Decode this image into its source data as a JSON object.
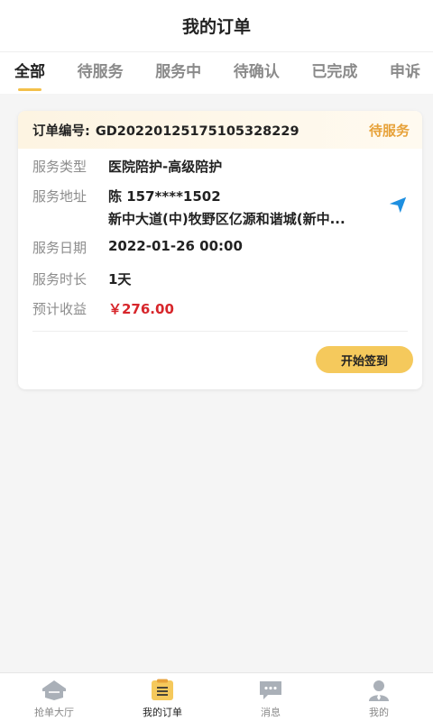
{
  "header": {
    "title": "我的订单"
  },
  "tabs": [
    {
      "label": "全部",
      "active": true
    },
    {
      "label": "待服务"
    },
    {
      "label": "服务中"
    },
    {
      "label": "待确认"
    },
    {
      "label": "已完成"
    },
    {
      "label": "申诉"
    }
  ],
  "order": {
    "number_label": "订单编号:",
    "number": "GD20220125175105328229",
    "status": "待服务",
    "service_type_label": "服务类型",
    "service_type": "医院陪护-高级陪护",
    "address_label": "服务地址",
    "contact": "陈 157****1502",
    "address": "新中大道(中)牧野区亿源和谐城(新中...",
    "date_label": "服务日期",
    "date": "2022-01-26 00:00",
    "duration_label": "服务时长",
    "duration": "1天",
    "income_label": "预计收益",
    "income": "￥276.00",
    "action_label": "开始签到"
  },
  "tabbar": [
    {
      "label": "抢单大厅",
      "icon": "hall-icon"
    },
    {
      "label": "我的订单",
      "icon": "orders-icon",
      "active": true
    },
    {
      "label": "消息",
      "icon": "message-icon"
    },
    {
      "label": "我的",
      "icon": "profile-icon"
    }
  ],
  "colors": {
    "accent": "#f5c95c",
    "status": "#e7a23a",
    "price": "#d7262b",
    "nav": "#1e8fe0"
  }
}
